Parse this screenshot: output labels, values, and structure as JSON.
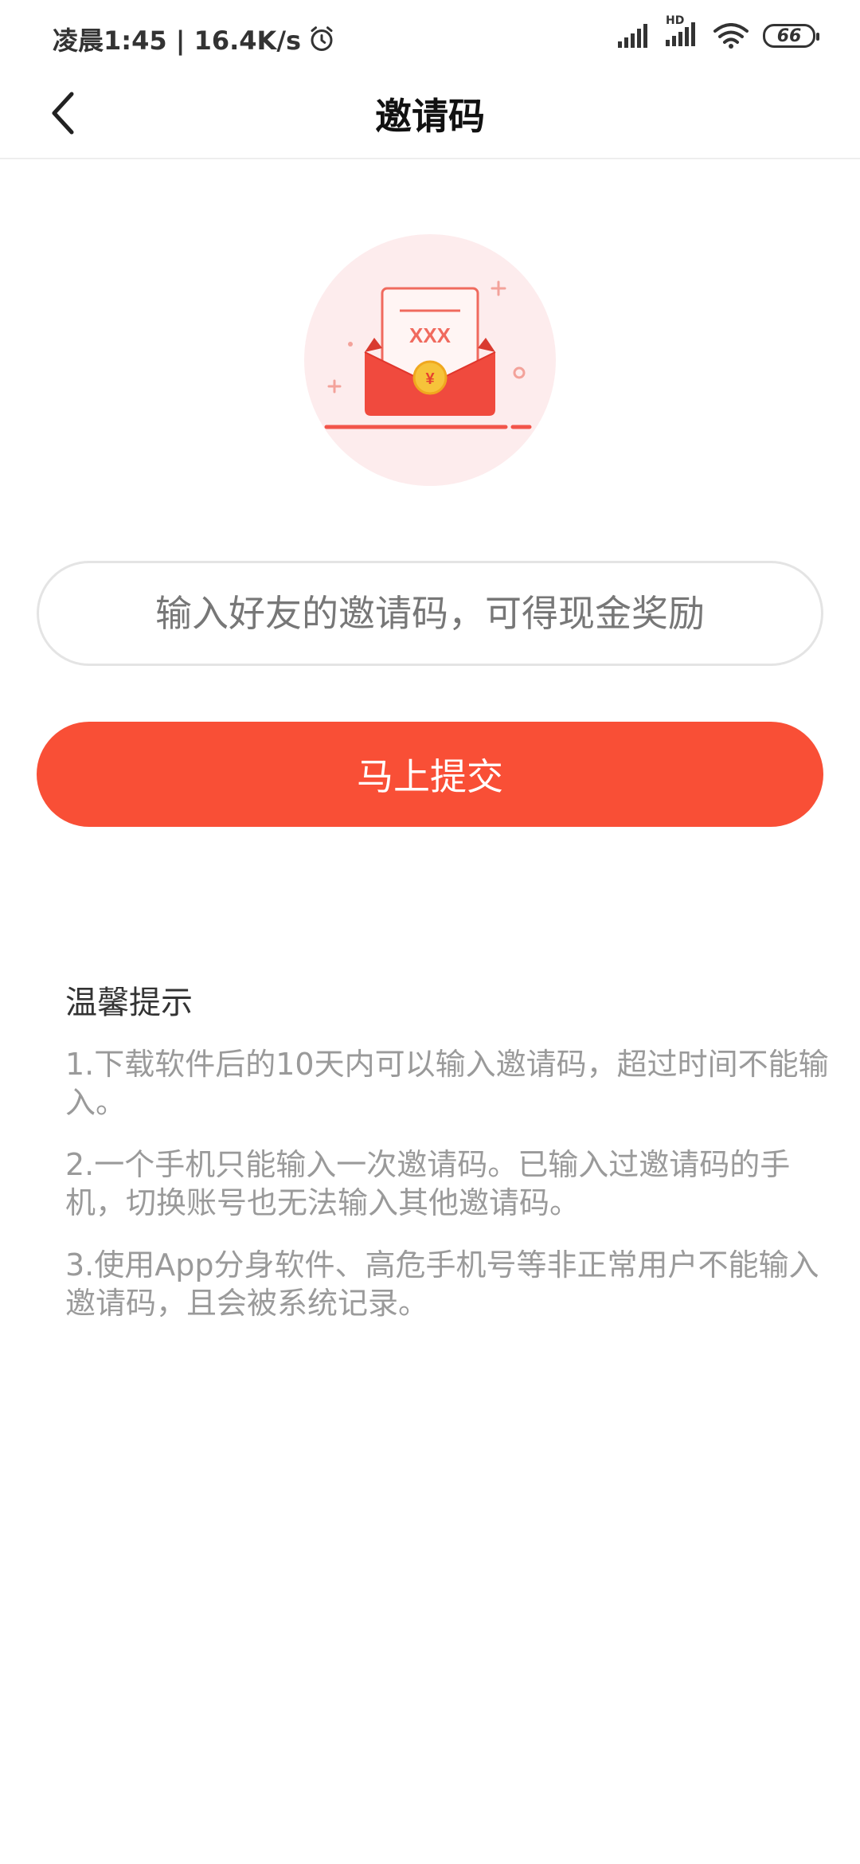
{
  "status_bar": {
    "time_speed": "凌晨1:45 | 16.4K/s",
    "battery": "66",
    "hd_label": "HD"
  },
  "nav": {
    "title": "邀请码"
  },
  "form": {
    "input_placeholder": "输入好友的邀请码，可得现金奖励",
    "input_value": "",
    "submit_label": "马上提交"
  },
  "illustration": {
    "envelope_text": "XXX",
    "coin_symbol": "¥"
  },
  "tips": {
    "title": "温馨提示",
    "items": [
      "1.下载软件后的10天内可以输入邀请码，超过时间不能输入。",
      "2.一个手机只能输入一次邀请码。已输入过邀请码的手机，切换账号也无法输入其他邀请码。",
      "3.使用App分身软件、高危手机号等非正常用户不能输入邀请码，且会被系统记录。"
    ]
  },
  "colors": {
    "accent": "#f94f36",
    "illustration_bg": "#fdeced",
    "envelope_red": "#f04a3e",
    "coin_gold": "#f6c33a"
  }
}
